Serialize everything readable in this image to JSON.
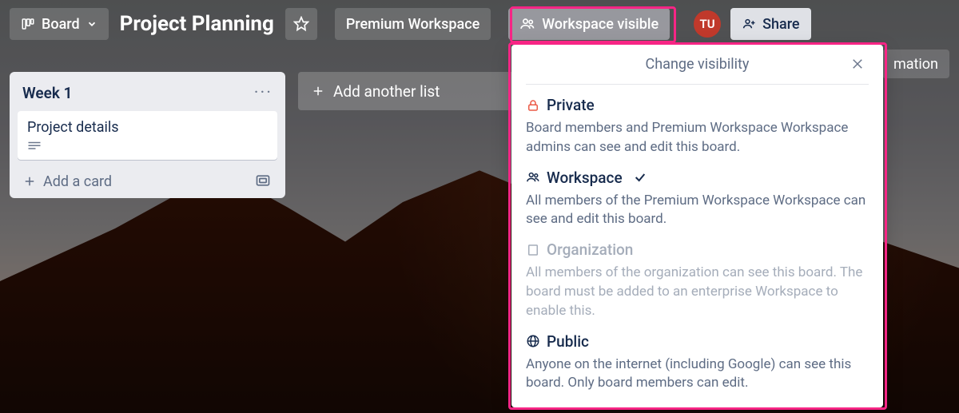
{
  "header": {
    "board_switcher_label": "Board",
    "title": "Project Planning",
    "workspace_button": "Premium Workspace",
    "visibility_button": "Workspace visible",
    "share_button": "Share",
    "automation_button": "mation",
    "avatar_initials": "TU"
  },
  "board": {
    "lists": [
      {
        "title": "Week 1",
        "cards": [
          {
            "title": "Project details",
            "has_description": true
          }
        ],
        "add_card_label": "Add a card"
      }
    ],
    "add_list_label": "Add another list"
  },
  "popover": {
    "title": "Change visibility",
    "options": [
      {
        "key": "private",
        "label": "Private",
        "description": "Board members and Premium Workspace Workspace admins can see and edit this board.",
        "selected": false,
        "disabled": false,
        "icon": "lock-icon",
        "icon_color": "#eb5a46"
      },
      {
        "key": "workspace",
        "label": "Workspace",
        "description": "All members of the Premium Workspace Workspace can see and edit this board.",
        "selected": true,
        "disabled": false,
        "icon": "people-icon",
        "icon_color": "#172b4d"
      },
      {
        "key": "organization",
        "label": "Organization",
        "description": "All members of the organization can see this board. The board must be added to an enterprise Workspace to enable this.",
        "selected": false,
        "disabled": true,
        "icon": "org-icon",
        "icon_color": "#a5adba"
      },
      {
        "key": "public",
        "label": "Public",
        "description": "Anyone on the internet (including Google) can see this board. Only board members can edit.",
        "selected": false,
        "disabled": false,
        "icon": "globe-icon",
        "icon_color": "#172b4d"
      }
    ]
  }
}
